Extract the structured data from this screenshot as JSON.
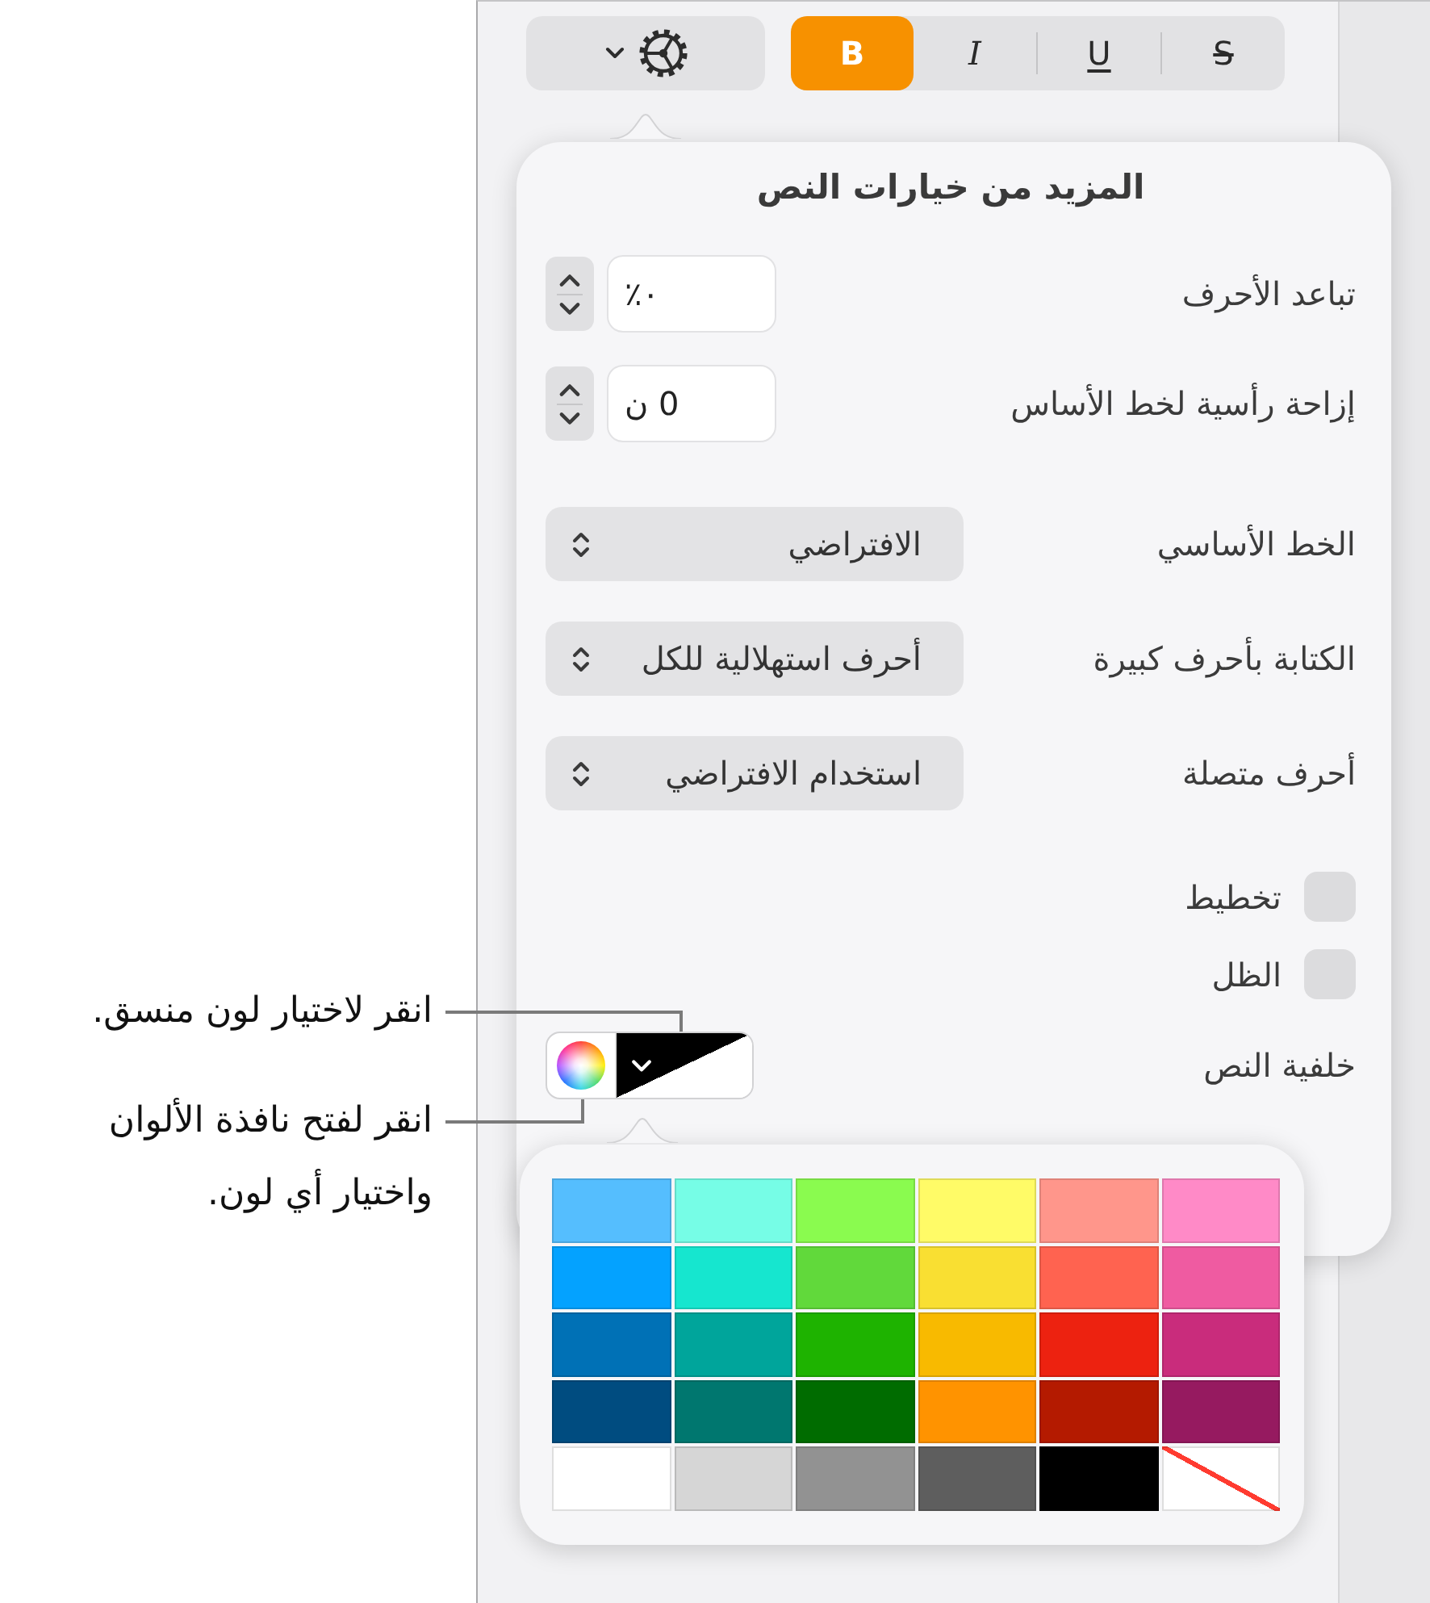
{
  "toolbar": {
    "style_buttons": [
      {
        "kind": "strikethrough",
        "label": "S",
        "selected": false
      },
      {
        "kind": "underline",
        "label": "U",
        "selected": false
      },
      {
        "kind": "italic",
        "label": "I",
        "selected": false
      },
      {
        "kind": "bold",
        "label": "B",
        "selected": true
      }
    ]
  },
  "text_options_popover": {
    "title": "المزيد من خيارات النص",
    "options": [
      {
        "kind": "stepper",
        "label": "تباعد الأحرف",
        "value": "٠٪"
      },
      {
        "kind": "stepper",
        "label": "إزاحة رأسية لخط الأساس",
        "value": "0 ن"
      },
      {
        "kind": "popup",
        "label": "الخط الأساسي",
        "value": "الافتراضي"
      },
      {
        "kind": "popup",
        "label": "الكتابة بأحرف كبيرة",
        "value": "أحرف استهلالية للكل"
      },
      {
        "kind": "popup",
        "label": "أحرف متصلة",
        "value": "استخدام الافتراضي"
      },
      {
        "kind": "checkbox",
        "label": "تخطيط",
        "checked": false
      },
      {
        "kind": "checkbox",
        "label": "الظل",
        "checked": false
      },
      {
        "kind": "color_well",
        "label": "خلفية النص"
      }
    ]
  },
  "color_palette": {
    "swatches": [
      {
        "kind": "color",
        "color": "#55befe"
      },
      {
        "kind": "color",
        "color": "#76fde6"
      },
      {
        "kind": "color",
        "color": "#8afb4f"
      },
      {
        "kind": "color",
        "color": "#fffb67"
      },
      {
        "kind": "color",
        "color": "#ff968b"
      },
      {
        "kind": "color",
        "color": "#ff8ac7"
      },
      {
        "kind": "color",
        "color": "#04a2ff"
      },
      {
        "kind": "color",
        "color": "#16e6cf"
      },
      {
        "kind": "color",
        "color": "#61d93b"
      },
      {
        "kind": "color",
        "color": "#f9df32"
      },
      {
        "kind": "color",
        "color": "#ff6350"
      },
      {
        "kind": "color",
        "color": "#ef5ba1"
      },
      {
        "kind": "color",
        "color": "#0071b6"
      },
      {
        "kind": "color",
        "color": "#00a59b"
      },
      {
        "kind": "color",
        "color": "#1eb300"
      },
      {
        "kind": "color",
        "color": "#f8ba00"
      },
      {
        "kind": "color",
        "color": "#ed2210"
      },
      {
        "kind": "color",
        "color": "#c92c7c"
      },
      {
        "kind": "color",
        "color": "#004c80"
      },
      {
        "kind": "color",
        "color": "#00776f"
      },
      {
        "kind": "color",
        "color": "#006c00"
      },
      {
        "kind": "color",
        "color": "#ff9300"
      },
      {
        "kind": "color",
        "color": "#b41a00"
      },
      {
        "kind": "color",
        "color": "#961a60"
      },
      {
        "kind": "color",
        "color": "#ffffff"
      },
      {
        "kind": "color",
        "color": "#d6d6d6"
      },
      {
        "kind": "color",
        "color": "#929292"
      },
      {
        "kind": "color",
        "color": "#5e5e5e"
      },
      {
        "kind": "color",
        "color": "#000000"
      },
      {
        "kind": "none"
      }
    ]
  },
  "callouts": [
    {
      "lines": [
        "انقر لاختيار لون منسق."
      ]
    },
    {
      "lines": [
        "انقر لفتح نافذة الألوان",
        "واختيار أي لون."
      ]
    }
  ]
}
